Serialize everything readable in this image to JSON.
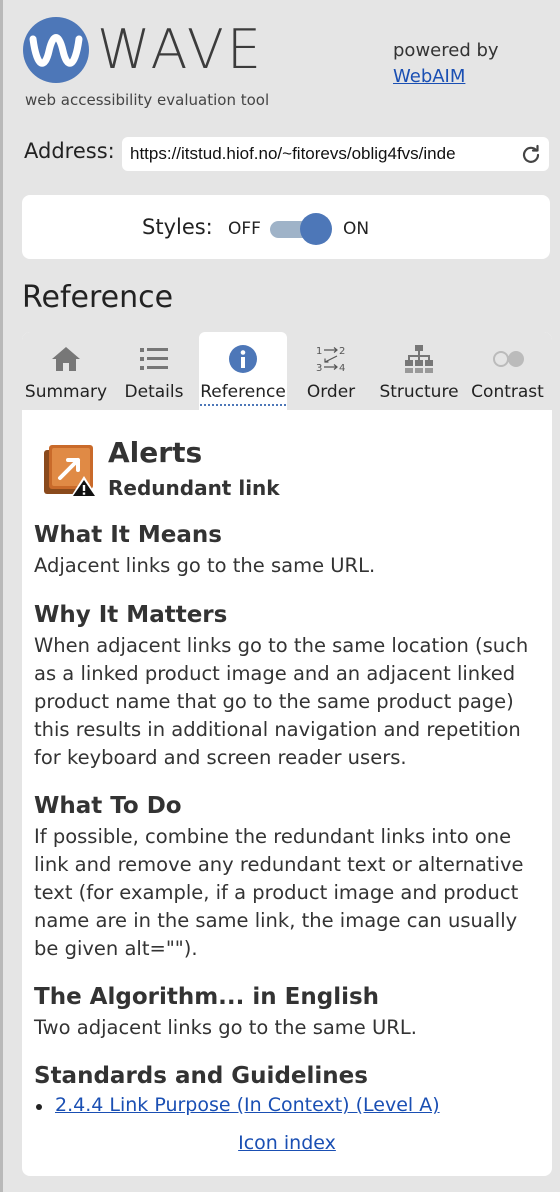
{
  "header": {
    "logo_text": "WAVE",
    "tagline": "web accessibility evaluation tool",
    "powered_by": "powered by",
    "webaim_link": "WebAIM"
  },
  "address": {
    "label": "Address:",
    "value": "https://itstud.hiof.no/~fitorevs/oblig4fvs/inde"
  },
  "styles": {
    "label": "Styles:",
    "off": "OFF",
    "on": "ON",
    "state": "on"
  },
  "section_title": "Reference",
  "tabs": [
    {
      "label": "Summary",
      "icon": "home-icon"
    },
    {
      "label": "Details",
      "icon": "list-icon"
    },
    {
      "label": "Reference",
      "icon": "info-icon",
      "active": true
    },
    {
      "label": "Order",
      "icon": "order-icon"
    },
    {
      "label": "Structure",
      "icon": "structure-icon"
    },
    {
      "label": "Contrast",
      "icon": "contrast-icon"
    }
  ],
  "order_icon_text": {
    "a": "1",
    "b": "2",
    "c": "3",
    "d": "4"
  },
  "reference": {
    "category": "Alerts",
    "item": "Redundant link",
    "what_it_means_title": "What It Means",
    "what_it_means": "Adjacent links go to the same URL.",
    "why_it_matters_title": "Why It Matters",
    "why_it_matters": "When adjacent links go to the same location (such as a linked product image and an adjacent linked product name that go to the same product page) this results in additional navigation and repetition for keyboard and screen reader users.",
    "what_to_do_title": "What To Do",
    "what_to_do": "If possible, combine the redundant links into one link and remove any redundant text or alternative text (for example, if a product image and product name are in the same link, the image can usually be given alt=\"\").",
    "algorithm_title": "The Algorithm... in English",
    "algorithm": "Two adjacent links go to the same URL.",
    "standards_title": "Standards and Guidelines",
    "standards": [
      "2.4.4 Link Purpose (In Context) (Level A)"
    ],
    "icon_index": "Icon index"
  },
  "colors": {
    "accent": "#4d77b8",
    "link": "#1a4fb3",
    "alert_orange": "#c96a2a"
  }
}
